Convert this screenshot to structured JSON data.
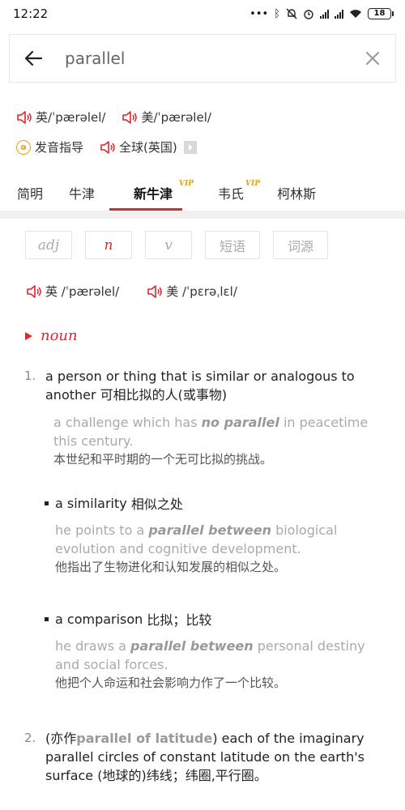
{
  "status": {
    "time": "12:22",
    "battery": "18"
  },
  "search": {
    "value": "parallel"
  },
  "pron": {
    "uk_label": "英",
    "uk_ipa": "/ˈpærəlel/",
    "us_label": "美",
    "us_ipa": "/ˈpærəlel/",
    "guide_label": "发音指导",
    "global_label": "全球(英国)"
  },
  "dict_tabs": [
    {
      "label": "简明"
    },
    {
      "label": "牛津"
    },
    {
      "label": "新牛津",
      "badge": "VIP"
    },
    {
      "label": "韦氏",
      "badge": "VIP"
    },
    {
      "label": "柯林斯"
    }
  ],
  "pos_chips": [
    "adj",
    "n",
    "v",
    "短语",
    "词源"
  ],
  "entry": {
    "uk_label": "英",
    "uk_ipa": "/ˈpærəlel/",
    "us_label": "美",
    "us_ipa": "/ˈpɛrəˌlɛl/",
    "pos": "noun",
    "defs": [
      {
        "num": "1.",
        "en": "a person or thing that is similar or analogous to another",
        "cn": "可相比拟的人(或事物)",
        "ex_pre": "a challenge which has ",
        "ex_bold": "no parallel",
        "ex_post": " in peacetime this century.",
        "ex_cn": "本世纪和平时期的一个无可比拟的挑战。"
      }
    ],
    "subs": [
      {
        "en": "a similarity",
        "cn": "相似之处",
        "ex_pre": "he points to a ",
        "ex_bold": "parallel between",
        "ex_post": " biological evolution and cognitive development.",
        "ex_cn": "他指出了生物进化和认知发展的相似之处。"
      },
      {
        "en": "a comparison",
        "cn": "比拟；比较",
        "ex_pre": "he draws a ",
        "ex_bold": "parallel between",
        "ex_post": " personal destiny and social forces.",
        "ex_cn": "他把个人命运和社会影响力作了一个比较。"
      }
    ],
    "def2": {
      "num": "2.",
      "pre": "(亦作",
      "bold": "parallel of latitude",
      "post": ") each of the imaginary parallel circles of constant latitude on the earth's surface (地球的)纬线；纬圈,平行圈。"
    }
  },
  "colors": {
    "accent": "#e0262f",
    "vip": "#d9a31c",
    "guide": "#e0a21a"
  }
}
